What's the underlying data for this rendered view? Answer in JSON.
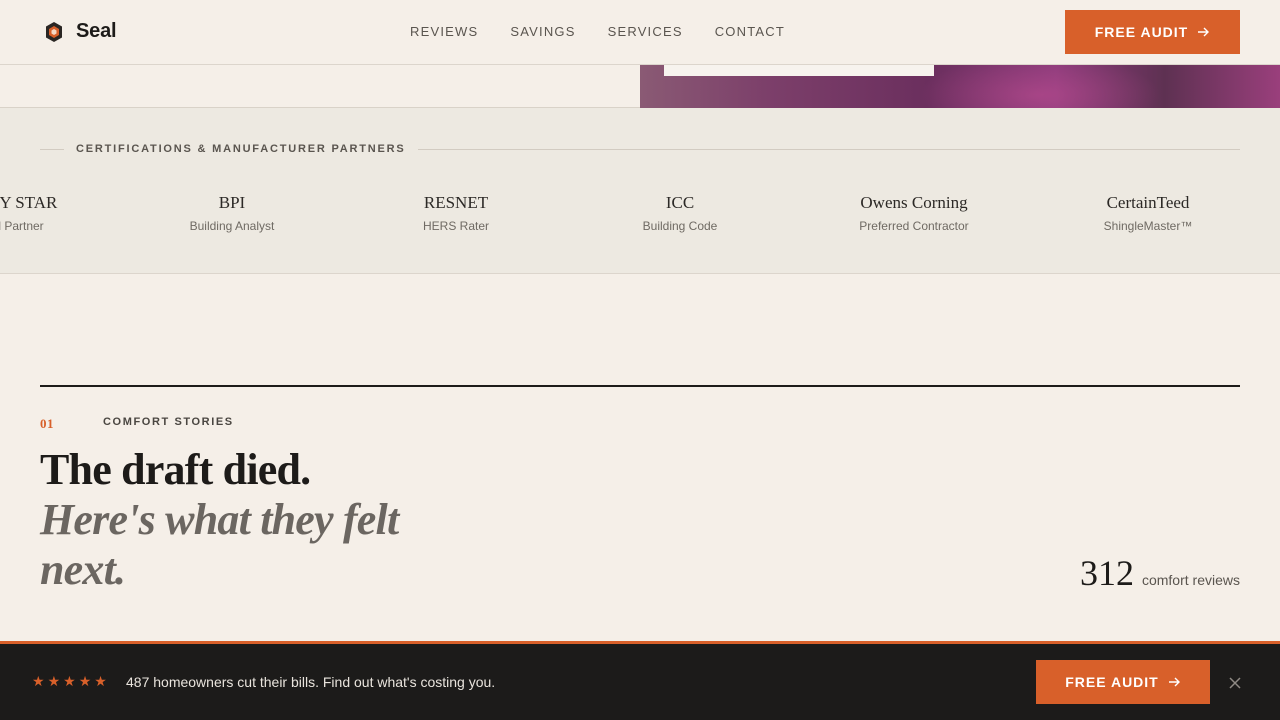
{
  "header": {
    "logo_text": "Seal",
    "nav": [
      "REVIEWS",
      "SAVINGS",
      "SERVICES",
      "CONTACT"
    ],
    "cta_label": "FREE AUDIT"
  },
  "partners": {
    "heading": "CERTIFICATIONS & MANUFACTURER PARTNERS",
    "items": [
      {
        "name": "ENERGY STAR",
        "sub": "Certified Partner"
      },
      {
        "name": "BPI",
        "sub": "Building Analyst"
      },
      {
        "name": "RESNET",
        "sub": "HERS Rater"
      },
      {
        "name": "ICC",
        "sub": "Building Code"
      },
      {
        "name": "Owens Corning",
        "sub": "Preferred Contractor"
      },
      {
        "name": "CertainTeed",
        "sub": "ShingleMaster™"
      }
    ]
  },
  "section": {
    "number": "01",
    "label": "COMFORT STORIES",
    "headline_line1": "The draft died.",
    "headline_line2": "Here's what they felt next.",
    "review_count": "312",
    "review_label": "comfort reviews"
  },
  "bottom_bar": {
    "stars": [
      "★",
      "★",
      "★",
      "★",
      "★"
    ],
    "text": "487 homeowners cut their bills. Find out what's costing you.",
    "cta_label": "FREE AUDIT"
  },
  "colors": {
    "accent": "#d8602a",
    "background": "#f5efe8",
    "dark": "#1c1b1a"
  },
  "icons": {
    "logo": "hexagon-shield-icon",
    "cta": "arrow-right-icon",
    "close": "close-icon",
    "rating": "star-icon"
  }
}
